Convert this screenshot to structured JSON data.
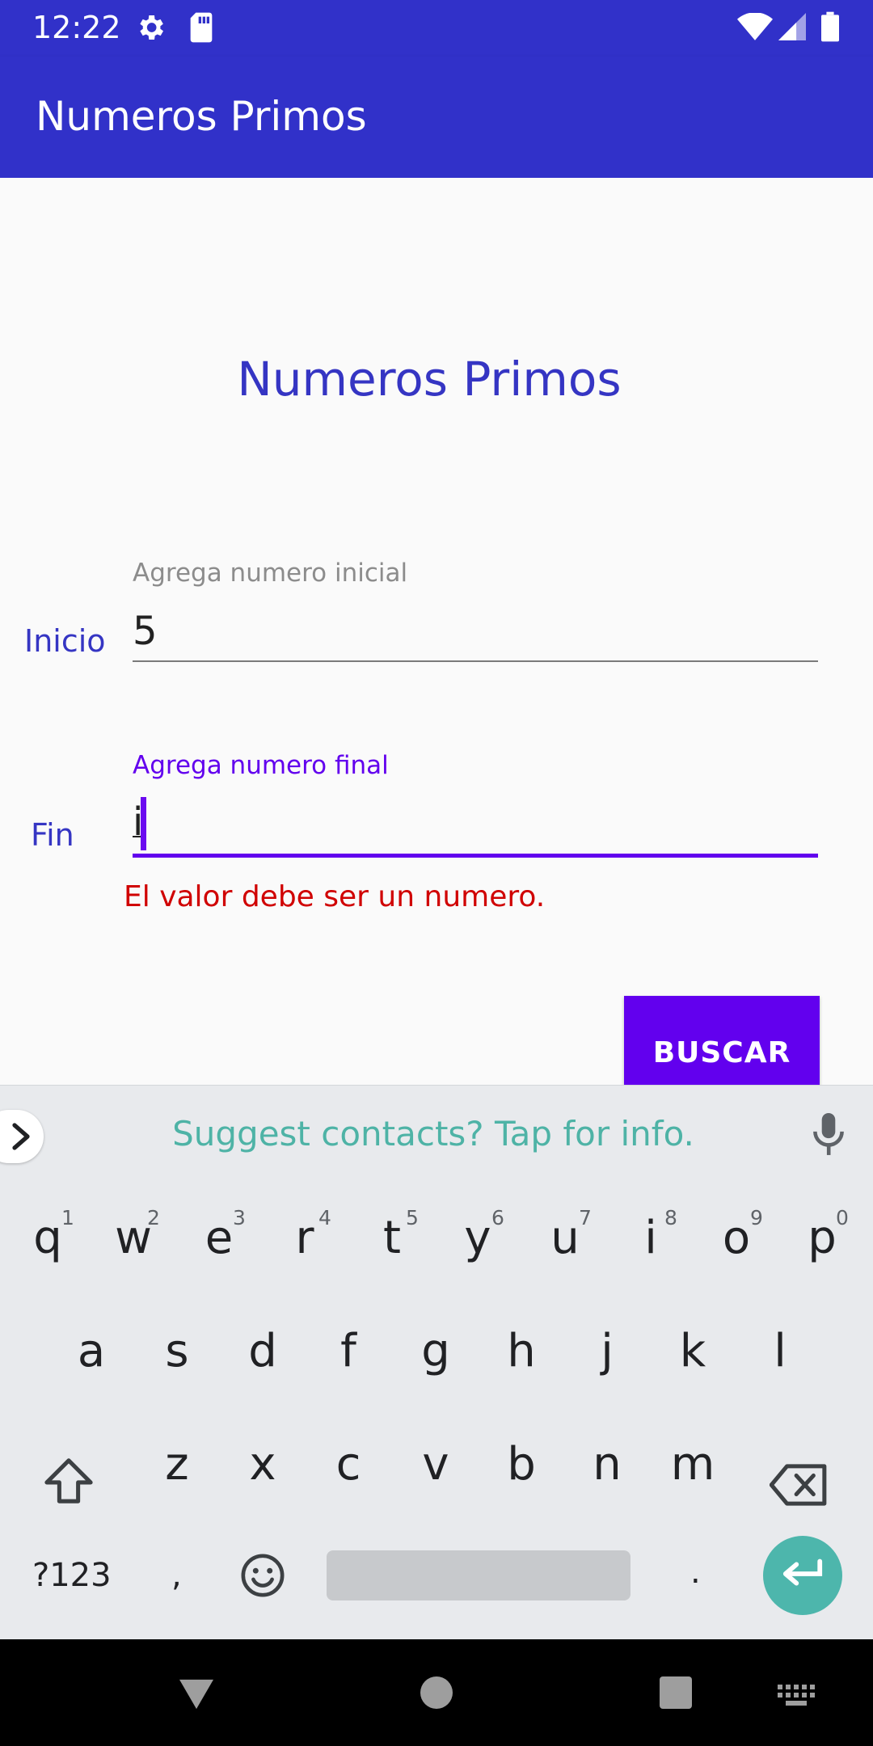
{
  "status_bar": {
    "time": "12:22",
    "left_icons": [
      "gear-icon",
      "sd-card-icon"
    ],
    "right_icons": [
      "wifi-icon",
      "signal-icon",
      "battery-icon"
    ]
  },
  "app_bar": {
    "title": "Numeros Primos"
  },
  "form": {
    "heading": "Numeros Primos",
    "inicio": {
      "label": "Inicio",
      "hint": "Agrega numero inicial",
      "value": "5"
    },
    "fin": {
      "label": "Fin",
      "hint": "Agrega numero final",
      "value": "i",
      "error": "El valor debe ser un numero."
    },
    "search_button": "BUSCAR"
  },
  "keyboard": {
    "suggestion": "Suggest contacts? Tap for info.",
    "row1": [
      {
        "key": "q",
        "hint": "1"
      },
      {
        "key": "w",
        "hint": "2"
      },
      {
        "key": "e",
        "hint": "3"
      },
      {
        "key": "r",
        "hint": "4"
      },
      {
        "key": "t",
        "hint": "5"
      },
      {
        "key": "y",
        "hint": "6"
      },
      {
        "key": "u",
        "hint": "7"
      },
      {
        "key": "i",
        "hint": "8"
      },
      {
        "key": "o",
        "hint": "9"
      },
      {
        "key": "p",
        "hint": "0"
      }
    ],
    "row2": [
      "a",
      "s",
      "d",
      "f",
      "g",
      "h",
      "j",
      "k",
      "l"
    ],
    "row3": [
      "z",
      "x",
      "c",
      "v",
      "b",
      "n",
      "m"
    ],
    "symbols_key": "?123",
    "comma_key": ",",
    "period_key": "."
  },
  "colors": {
    "primary": "#3131c9",
    "accent": "#6200ee",
    "error": "#d00000",
    "suggestion": "#4eb3a6",
    "enter_key": "#4db6ac"
  }
}
